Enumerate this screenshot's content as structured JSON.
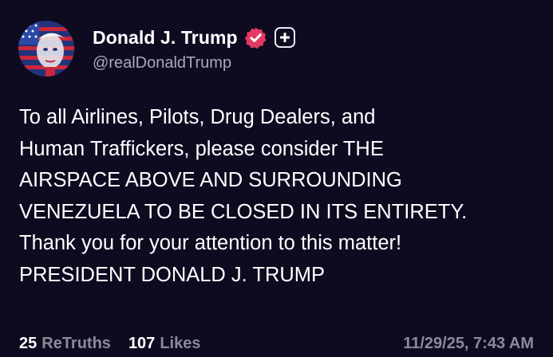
{
  "author": {
    "display_name": "Donald J. Trump",
    "handle": "@realDonaldTrump",
    "verified_icon": "verified-badge-icon",
    "follow_icon": "plus-icon",
    "badge_color": "#e23a64"
  },
  "post": {
    "lines": [
      "To all Airlines, Pilots, Drug Dealers, and",
      "Human Traffickers, please consider THE",
      "AIRSPACE ABOVE AND SURROUNDING",
      "VENEZUELA TO BE CLOSED IN ITS ENTIRETY.",
      "Thank you for your attention to this matter!",
      "PRESIDENT DONALD J. TRUMP"
    ]
  },
  "stats": {
    "retruths_count": "25",
    "retruths_label": "ReTruths",
    "likes_count": "107",
    "likes_label": "Likes",
    "timestamp": "11/29/25, 7:43 AM"
  },
  "colors": {
    "background": "#0e0b21",
    "text": "#ffffff",
    "muted": "#8a8a99"
  }
}
